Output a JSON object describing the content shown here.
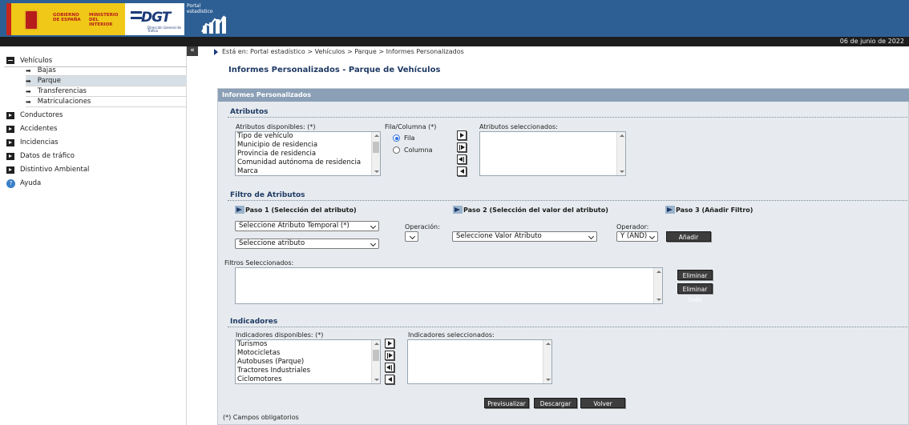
{
  "header": {
    "gov_text": "GOBIERNO DE ESPAÑA",
    "ministry_text": "MINISTERIO DEL INTERIOR",
    "dgt_logo": "DGT",
    "dgt_sub": "Dirección General de Tráfico",
    "portal_label": "Portal estadístico"
  },
  "date": "06 de junio de 2022",
  "sidebar": {
    "collapse": "«",
    "section_vehiculos": "Vehículos",
    "vehiculos_items": [
      {
        "label": "Bajas"
      },
      {
        "label": "Parque"
      },
      {
        "label": "Transferencias"
      },
      {
        "label": "Matriculaciones"
      }
    ],
    "items": [
      {
        "label": "Conductores"
      },
      {
        "label": "Accidentes"
      },
      {
        "label": "Incidencias"
      },
      {
        "label": "Datos de tráfico"
      },
      {
        "label": "Distintivo Ambiental"
      }
    ],
    "help": "Ayuda"
  },
  "breadcrumb": "Está en: Portal estadístico > Vehículos > Parque > Informes Personalizados",
  "page_title": "Informes Personalizados - Parque de Vehículos",
  "panel": {
    "header": "Informes Personalizados",
    "atributos": {
      "title": "Atributos",
      "available_label": "Atributos disponibles: (*)",
      "available": [
        "Tipo de vehículo",
        "Municipio de residencia",
        "Provincia de residencia",
        "Comunidad autónoma de residencia",
        "Marca"
      ],
      "filacol_label": "Fila/Columna (*)",
      "fila": "Fila",
      "columna": "Columna",
      "selected_label": "Atributos seleccionados:"
    },
    "filtro": {
      "title": "Filtro de Atributos",
      "paso1": "Paso 1 (Selección del atributo)",
      "paso2": "Paso 2 (Selección del valor del atributo)",
      "paso3": "Paso 3 (Añadir Filtro)",
      "select_temporal": "Seleccione Atributo Temporal (*)",
      "select_atributo": "Seleccione atributo",
      "operacion_label": "Operación:",
      "select_valor": "Seleccione Valor Atributo",
      "operador_label": "Operador:",
      "operador_value": "Y (AND)",
      "anadir": "Añadir",
      "seleccionados_label": "Filtros Seleccionados:",
      "eliminar": "Eliminar",
      "eliminar_todo": "Eliminar todo"
    },
    "indicadores": {
      "title": "Indicadores",
      "available_label": "Indicadores disponibles: (*)",
      "available": [
        "Turismos",
        "Motocicletas",
        "Autobuses (Parque)",
        "Tractores Industriales",
        "Ciclomotores"
      ],
      "selected_label": "Indicadores seleccionados:"
    },
    "buttons": {
      "previsualizar": "Previsualizar",
      "descargar": "Descargar",
      "volver": "Volver"
    },
    "footnote": "(*) Campos obligatorios"
  },
  "colors": {
    "header_blue": "#2e5f94",
    "panel_head": "#8ba0b7",
    "panel_bg": "#e7ebef",
    "title_blue": "#1f3a64"
  }
}
